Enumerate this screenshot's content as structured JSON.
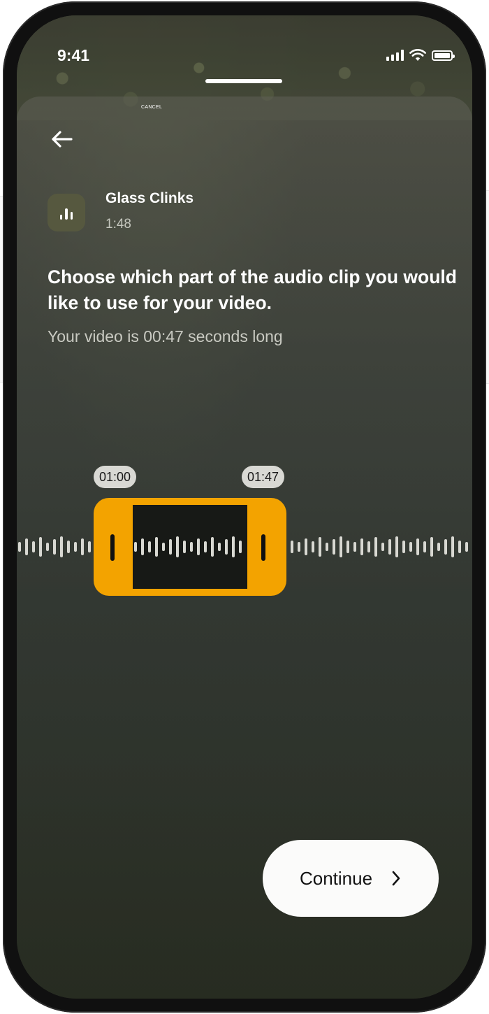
{
  "status_bar": {
    "time": "9:41"
  },
  "sheet": {
    "cancel_label": "CANCEL"
  },
  "track": {
    "title": "Glass Clinks",
    "duration": "1:48"
  },
  "prompt": {
    "heading": "Choose which part of the audio clip you would like to use for your video.",
    "subtext": "Your video is 00:47 seconds long"
  },
  "trim": {
    "start_time": "01:00",
    "end_time": "01:47",
    "accent_color": "#f3a300"
  },
  "actions": {
    "continue_label": "Continue"
  },
  "icons": {
    "back": "arrow-left-icon",
    "track": "audio-bars-icon",
    "continue": "chevron-right-icon",
    "signal": "cellular-signal-icon",
    "wifi": "wifi-icon",
    "battery": "battery-icon"
  }
}
